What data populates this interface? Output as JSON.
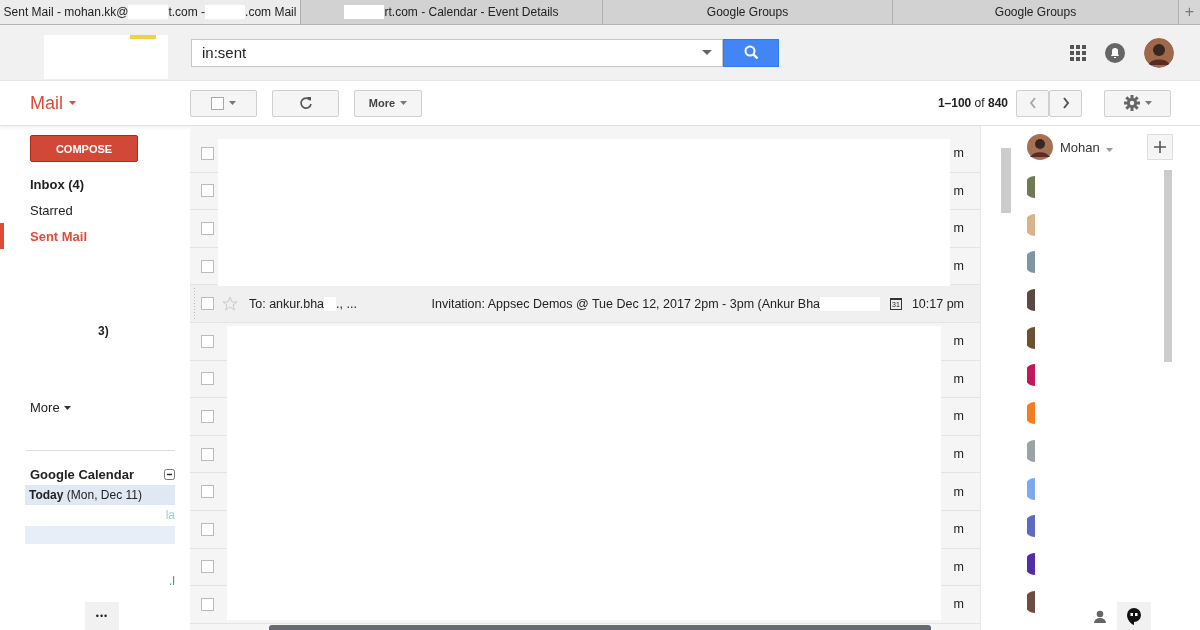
{
  "browser_tabs": [
    {
      "parts": [
        {
          "kind": "text",
          "text": "Sent Mail - mohan.kk@"
        },
        {
          "kind": "redaction"
        },
        {
          "kind": "text",
          "text": "t.com -"
        },
        {
          "kind": "redaction"
        },
        {
          "kind": "text",
          "text": ".com Mail"
        }
      ],
      "selected": true
    },
    {
      "parts": [
        {
          "kind": "redaction"
        },
        {
          "kind": "text",
          "text": "rt.com - Calendar - Event Details"
        }
      ],
      "selected": false
    },
    {
      "parts": [
        {
          "kind": "text",
          "text": "Google Groups"
        }
      ],
      "selected": false
    },
    {
      "parts": [
        {
          "kind": "text",
          "text": "Google Groups"
        }
      ],
      "selected": false
    }
  ],
  "new_tab": "+",
  "search": {
    "value": "in:sent"
  },
  "toolbar": {
    "app_menu": "Mail",
    "more": "More",
    "pagination": "**1–100** of **840**"
  },
  "sidebar": {
    "compose": "COMPOSE",
    "items": [
      {
        "label": "Inbox (4)",
        "bold": true,
        "selected": false
      },
      {
        "label": "Starred",
        "bold": false,
        "selected": false
      },
      {
        "label": "Sent Mail",
        "bold": false,
        "selected": true
      }
    ],
    "fragment": "3)",
    "more": "More",
    "calendar": {
      "title": "Google Calendar",
      "today": "**Today** (Mon, Dec 11)",
      "fragments": [
        "la",
        ".l"
      ]
    },
    "footer": "•••"
  },
  "emails": [
    {
      "kind": "redacted",
      "time": "m",
      "checked": false
    },
    {
      "kind": "redacted",
      "time": "m",
      "checked": false
    },
    {
      "kind": "redacted",
      "time": "m",
      "checked": false
    },
    {
      "kind": "redacted",
      "time": "m",
      "checked": false
    },
    {
      "kind": "full",
      "sender": "To: ankur.bha",
      "sender_tail": "., ...",
      "subject": "Invitation: Appsec Demos @ Tue Dec 12, 2017 2pm - 3pm (Ankur Bha",
      "calendar_day": "31",
      "time": "10:17 pm",
      "checked": false,
      "starred": false
    },
    {
      "kind": "redacted",
      "time": "m",
      "checked": false
    },
    {
      "kind": "redacted",
      "time": "m",
      "checked": false
    },
    {
      "kind": "redacted",
      "time": "m",
      "checked": false
    },
    {
      "kind": "redacted",
      "time": "m",
      "checked": false
    },
    {
      "kind": "redacted",
      "time": "m",
      "checked": false
    },
    {
      "kind": "redacted",
      "time": "m",
      "checked": false
    },
    {
      "kind": "redacted",
      "time": "m",
      "checked": false
    },
    {
      "kind": "redacted",
      "time": "m",
      "checked": false
    }
  ],
  "chat": {
    "user": "Mohan",
    "contacts": [
      {
        "color": "#6f7a55"
      },
      {
        "color": "#d8b48a"
      },
      {
        "color": "#7f95a3"
      },
      {
        "color": "#5a4a44"
      },
      {
        "color": "#6b5034"
      },
      {
        "color": "#c2185b"
      },
      {
        "color": "#f57c20"
      },
      {
        "color": "#9aa3a6"
      },
      {
        "color": "#7fa8f0"
      },
      {
        "color": "#5c6bc0"
      },
      {
        "color": "#512da8"
      },
      {
        "color": "#6d4c41"
      }
    ]
  }
}
